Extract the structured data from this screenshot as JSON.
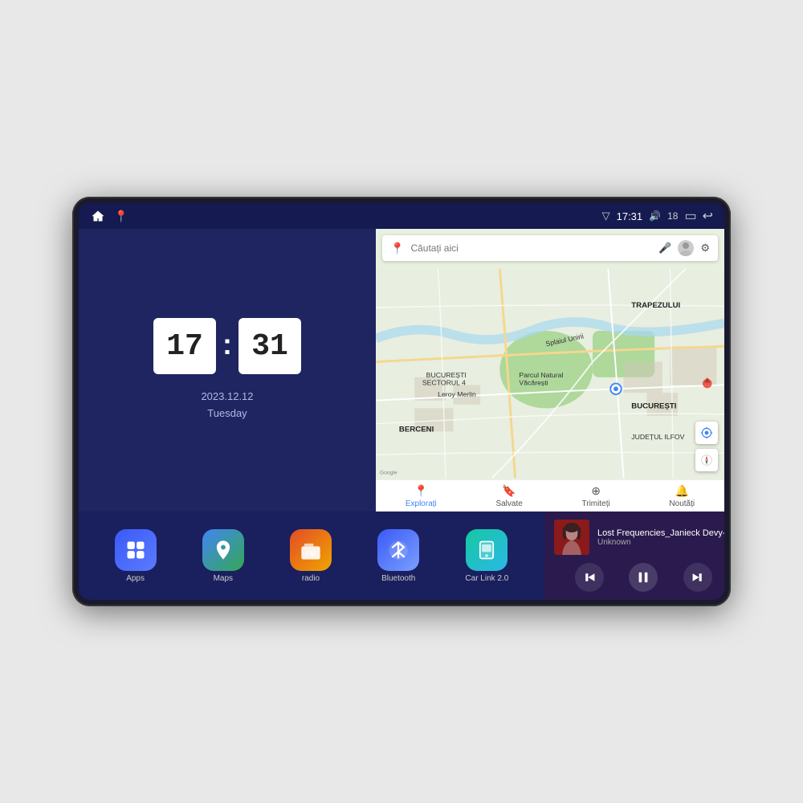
{
  "device": {
    "screen_bg": "#1a1f5e"
  },
  "status_bar": {
    "signal_icon": "▽",
    "time": "17:31",
    "volume_icon": "🔊",
    "battery_level": "18",
    "battery_icon": "▭",
    "back_icon": "↩",
    "home_label": "⌂",
    "maps_nav_label": "📍"
  },
  "clock": {
    "hours": "17",
    "minutes": "31",
    "date": "2023.12.12",
    "day": "Tuesday"
  },
  "map": {
    "search_placeholder": "Căutați aici",
    "nav_items": [
      {
        "label": "Explorați",
        "icon": "📍",
        "active": true
      },
      {
        "label": "Salvate",
        "icon": "🔖",
        "active": false
      },
      {
        "label": "Trimiteți",
        "icon": "⊕",
        "active": false
      },
      {
        "label": "Noutăți",
        "icon": "🔔",
        "active": false
      }
    ],
    "labels": [
      "TRAPEZULUI",
      "BUCUREȘTI",
      "JUDEȚUL ILFOV",
      "BERCENI",
      "Parcul Natural Văcărești",
      "Leroy Merlin",
      "BUCUREȘTI SECTORUL 4"
    ]
  },
  "apps": [
    {
      "id": "apps",
      "label": "Apps",
      "icon_class": "icon-apps",
      "icon": "⊞"
    },
    {
      "id": "maps",
      "label": "Maps",
      "icon_class": "icon-maps",
      "icon": "📍"
    },
    {
      "id": "radio",
      "label": "radio",
      "icon_class": "icon-radio",
      "icon": "📻"
    },
    {
      "id": "bluetooth",
      "label": "Bluetooth",
      "icon_class": "icon-bluetooth",
      "icon": "⟡"
    },
    {
      "id": "carlink",
      "label": "Car Link 2.0",
      "icon_class": "icon-carlink",
      "icon": "📱"
    }
  ],
  "music": {
    "title": "Lost Frequencies_Janieck Devy-...",
    "artist": "Unknown",
    "prev_icon": "⏮",
    "play_icon": "⏸",
    "next_icon": "⏭"
  }
}
